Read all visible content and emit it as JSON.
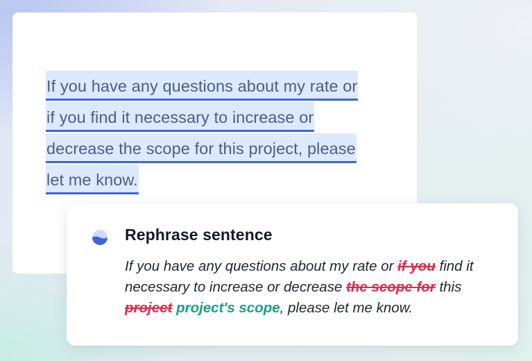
{
  "editor": {
    "lines": [
      "If you have any questions about my rate or",
      "if you find it necessary to increase or",
      "decrease the scope for this project, please",
      "let me know."
    ]
  },
  "suggestion": {
    "icon": "assistant-spinner-icon",
    "title": "Rephrase sentence",
    "segments": {
      "s1": "If you have any questions about my rate or ",
      "d1": "if you",
      "s2": " find it necessary to increase or decrease ",
      "d2": "the scope for",
      "s3": " this ",
      "d3": "project",
      "s4": " ",
      "i1": "project's scope",
      "s5": ", please let me know."
    }
  },
  "colors": {
    "highlight": "#dce9ff",
    "underline": "#3e63dd",
    "deletion": "#e0294b",
    "insertion": "#17a17a"
  }
}
